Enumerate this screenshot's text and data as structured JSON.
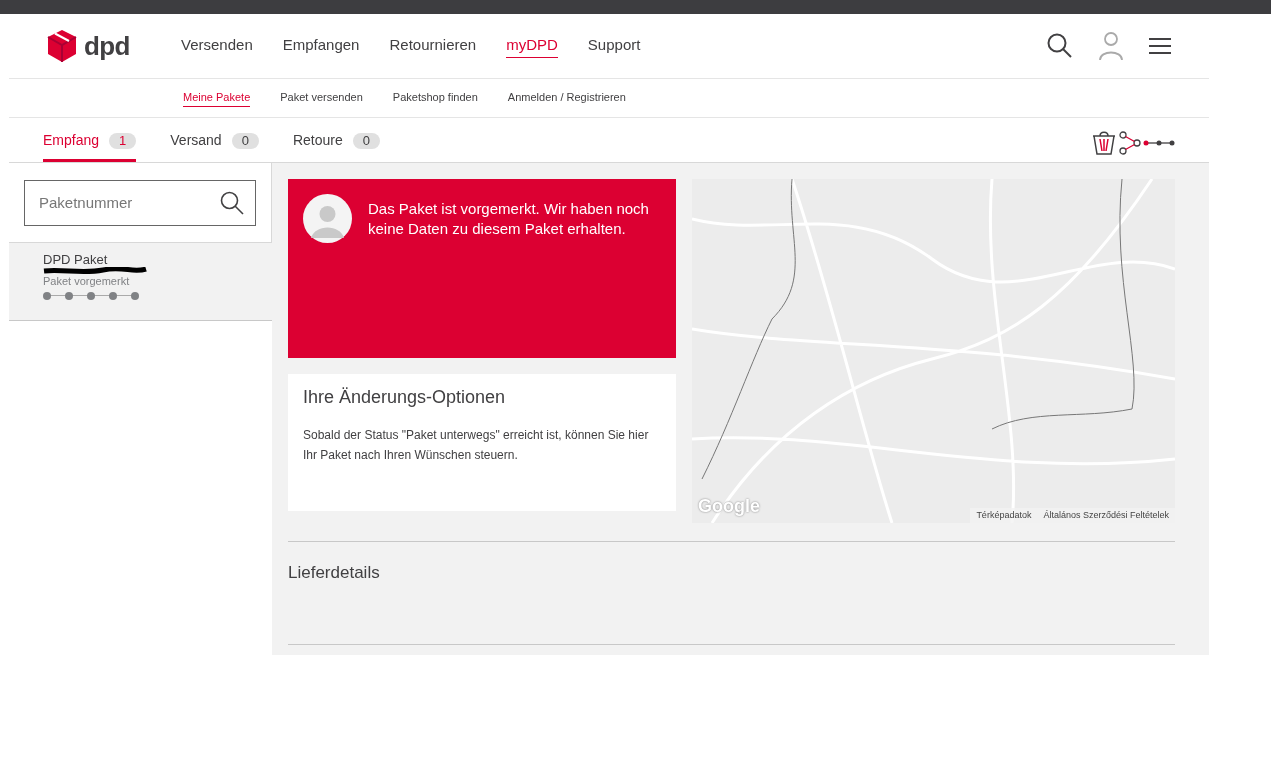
{
  "logo": {
    "text": "dpd"
  },
  "main_nav": [
    {
      "label": "Versenden",
      "selected": false
    },
    {
      "label": "Empfangen",
      "selected": false
    },
    {
      "label": "Retournieren",
      "selected": false
    },
    {
      "label": "myDPD",
      "selected": true
    },
    {
      "label": "Support",
      "selected": false
    }
  ],
  "sub_nav": [
    {
      "label": "Meine Pakete",
      "selected": true
    },
    {
      "label": "Paket versenden",
      "selected": false
    },
    {
      "label": "Paketshop finden",
      "selected": false
    },
    {
      "label": "Anmelden / Registrieren",
      "selected": false
    }
  ],
  "tabs": [
    {
      "label": "Empfang",
      "count": "1",
      "selected": true
    },
    {
      "label": "Versand",
      "count": "0",
      "selected": false
    },
    {
      "label": "Retoure",
      "count": "0",
      "selected": false
    }
  ],
  "search": {
    "placeholder": "Paketnummer"
  },
  "parcels": [
    {
      "title": "DPD Paket",
      "status": "Paket vorgemerkt",
      "selected": true,
      "steps": [
        {
          "done": false
        },
        {
          "done": false
        },
        {
          "done": false
        },
        {
          "done": false
        },
        {
          "done": false
        }
      ]
    }
  ],
  "status_card": {
    "message": "Das Paket ist vorgemerkt. Wir haben noch keine Daten zu diesem Paket erhalten."
  },
  "options_card": {
    "title": "Ihre Änderungs-Optionen",
    "text": "Sobald der Status \"Paket unterwegs\" erreicht ist, können Sie hier Ihr Paket nach Ihren Wünschen steuern."
  },
  "map": {
    "logo": "Google",
    "links": [
      "Térképadatok",
      "Általános Szerződési Feltételek"
    ]
  },
  "delivery_details": {
    "title": "Lieferdetails"
  }
}
